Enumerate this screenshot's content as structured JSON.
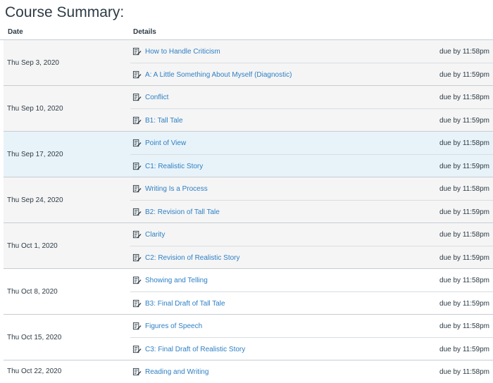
{
  "page": {
    "title": "Course Summary:"
  },
  "columns": {
    "date": "Date",
    "details": "Details"
  },
  "icon": "assignment-icon",
  "groups": [
    {
      "date": "Thu Sep 3, 2020",
      "items": [
        {
          "title": "How to Handle Criticism",
          "due": "due by 11:58pm"
        },
        {
          "title": "A: A Little Something About Myself (Diagnostic)",
          "due": "due by 11:59pm"
        }
      ]
    },
    {
      "date": "Thu Sep 10, 2020",
      "items": [
        {
          "title": "Conflict",
          "due": "due by 11:58pm"
        },
        {
          "title": "B1: Tall Tale",
          "due": "due by 11:59pm"
        }
      ]
    },
    {
      "date": "Thu Sep 17, 2020",
      "items": [
        {
          "title": "Point of View",
          "due": "due by 11:58pm"
        },
        {
          "title": "C1: Realistic Story",
          "due": "due by 11:59pm"
        }
      ]
    },
    {
      "date": "Thu Sep 24, 2020",
      "items": [
        {
          "title": "Writing Is a Process",
          "due": "due by 11:58pm"
        },
        {
          "title": "B2: Revision of Tall Tale",
          "due": "due by 11:59pm"
        }
      ]
    },
    {
      "date": "Thu Oct 1, 2020",
      "items": [
        {
          "title": "Clarity",
          "due": "due by 11:58pm"
        },
        {
          "title": "C2: Revision of Realistic Story",
          "due": "due by 11:59pm"
        }
      ]
    },
    {
      "date": "Thu Oct 8, 2020",
      "items": [
        {
          "title": "Showing and Telling",
          "due": "due by 11:58pm"
        },
        {
          "title": "B3: Final Draft of Tall Tale",
          "due": "due by 11:59pm"
        }
      ]
    },
    {
      "date": "Thu Oct 15, 2020",
      "items": [
        {
          "title": "Figures of Speech",
          "due": "due by 11:58pm"
        },
        {
          "title": "C3: Final Draft of Realistic Story",
          "due": "due by 11:59pm"
        }
      ]
    },
    {
      "date": "Thu Oct 22, 2020",
      "items": [
        {
          "title": "Reading and Writing",
          "due": "due by 11:58pm"
        }
      ]
    }
  ]
}
